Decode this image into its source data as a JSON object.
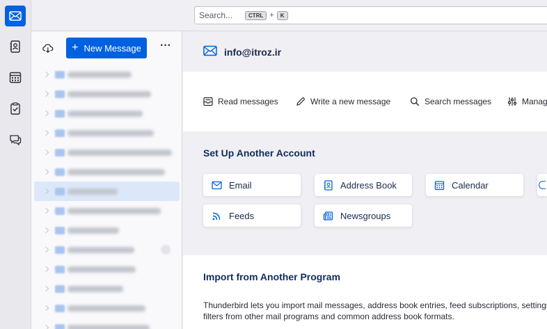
{
  "search": {
    "placeholder": "Search...",
    "key1": "CTRL",
    "plus": "+",
    "key2": "K"
  },
  "spaces": [
    "mail-icon",
    "address-book-icon",
    "calendar-icon",
    "tasks-icon",
    "chat-icon"
  ],
  "folder_pane": {
    "new_message_label": "New Message",
    "more_label": "···",
    "folders": [
      {
        "w": 92
      },
      {
        "w": 120
      },
      {
        "w": 108
      },
      {
        "w": 124
      },
      {
        "w": 150
      },
      {
        "w": 140
      },
      {
        "w": 72,
        "selected": true
      },
      {
        "w": 134
      },
      {
        "w": 74
      },
      {
        "w": 96,
        "badge": true
      },
      {
        "w": 98
      },
      {
        "w": 80
      },
      {
        "w": 112
      },
      {
        "w": 118
      }
    ]
  },
  "account": {
    "email": "info@itroz.ir"
  },
  "actions": {
    "read": "Read messages",
    "write": "Write a new message",
    "search": "Search messages",
    "manage": "Manage"
  },
  "setup": {
    "title": "Set Up Another Account",
    "email": "Email",
    "address_book": "Address Book",
    "calendar": "Calendar",
    "feeds": "Feeds",
    "newsgroups": "Newsgroups"
  },
  "import": {
    "title": "Import from Another Program",
    "line1": "Thunderbird lets you import mail messages, address book entries, feed subscriptions, settings, and/or",
    "line2": "filters from other mail programs and common address book formats."
  },
  "colors": {
    "accent": "#0061e0",
    "title": "#0f2d5e"
  }
}
